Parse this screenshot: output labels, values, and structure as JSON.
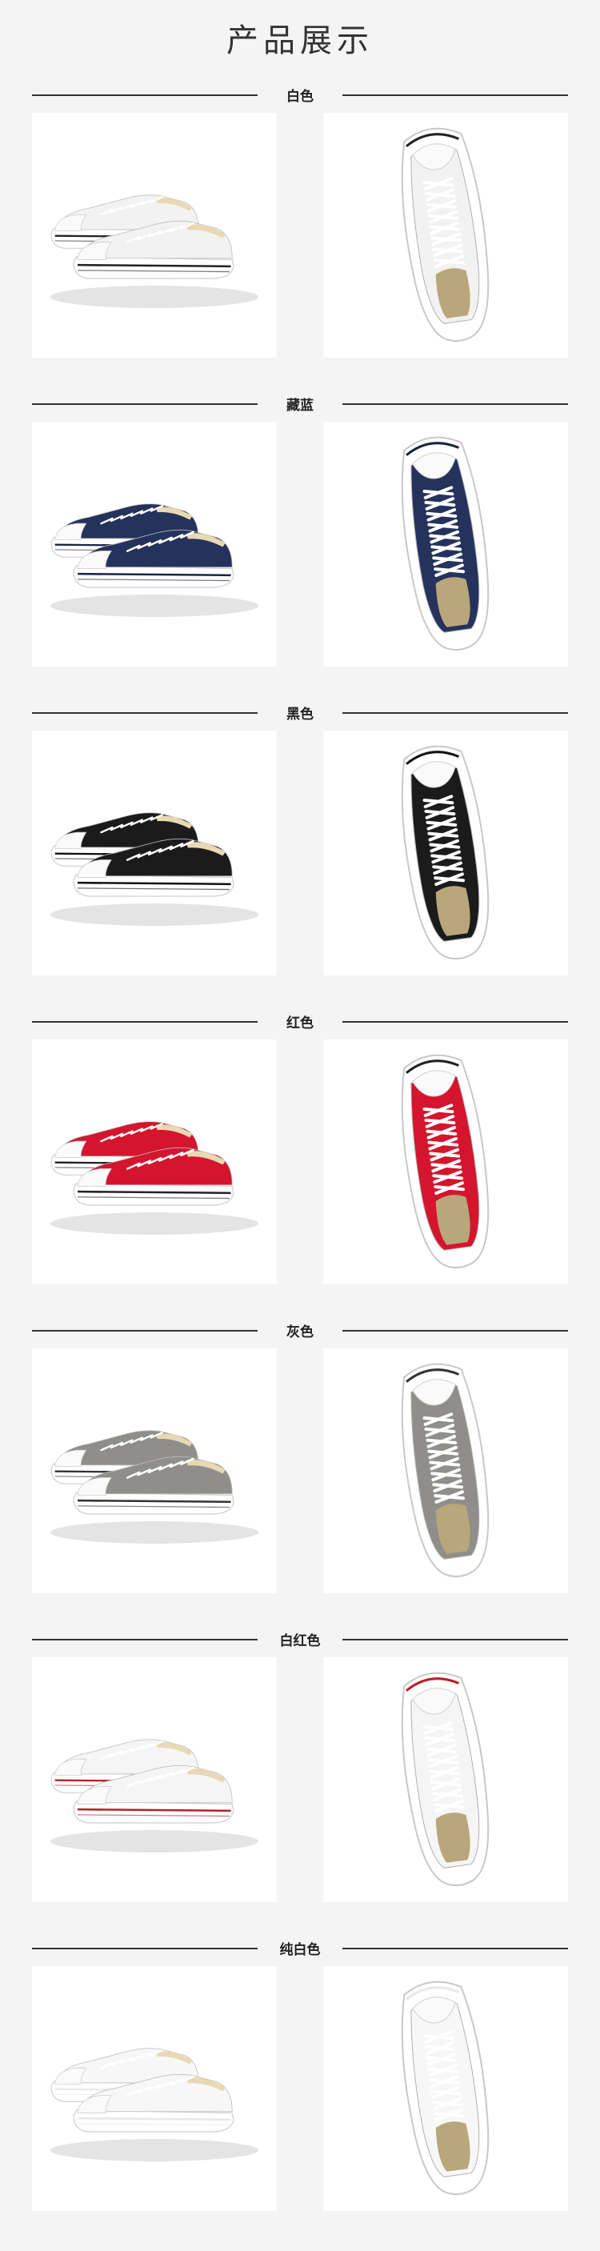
{
  "page_title": "产品展示",
  "colors": {
    "background": "#f4f4f4",
    "card": "#ffffff",
    "divider": "#333333"
  },
  "sections": [
    {
      "label": "白色",
      "upper": "#f2f2f2",
      "stripe": "#222222",
      "toe": "#fafafa"
    },
    {
      "label": "藏蓝",
      "upper": "#24325c",
      "stripe": "#1a2544",
      "toe": "#fafafa"
    },
    {
      "label": "黑色",
      "upper": "#1b1b1b",
      "stripe": "#111111",
      "toe": "#fafafa"
    },
    {
      "label": "红色",
      "upper": "#d4152d",
      "stripe": "#222222",
      "toe": "#fafafa"
    },
    {
      "label": "灰色",
      "upper": "#8f8e8a",
      "stripe": "#333333",
      "toe": "#fafafa"
    },
    {
      "label": "白红色",
      "upper": "#f5f5f5",
      "stripe": "#b81f26",
      "toe": "#fafafa"
    },
    {
      "label": "纯白色",
      "upper": "#f7f7f7",
      "stripe": "#e8e8e8",
      "toe": "#fafafa"
    }
  ]
}
